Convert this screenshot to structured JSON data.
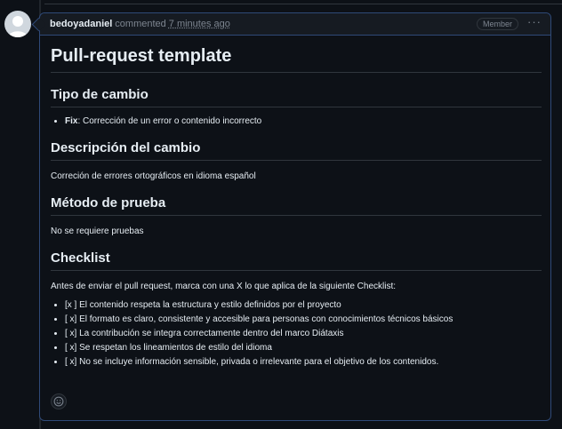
{
  "comment": {
    "author": "bedoyadaniel",
    "action": "commented",
    "time": "7 minutes ago",
    "badge": "Member",
    "menu_icon": "kebab-horizontal-icon"
  },
  "content": {
    "title": "Pull-request template",
    "type_heading": "Tipo de cambio",
    "type_items": [
      {
        "strong": "Fix",
        "text": ": Corrección de un error o contenido incorrecto"
      }
    ],
    "desc_heading": "Descripción del cambio",
    "desc_text": "Correción de errores ortográficos en idioma español",
    "test_heading": "Método de prueba",
    "test_text": "No se requiere pruebas",
    "checklist_heading": "Checklist",
    "checklist_intro": "Antes de enviar el pull request, marca con una X lo que aplica de la siguiente Checklist:",
    "checklist_items": [
      "[x ] El contenido respeta la estructura y estilo definidos por el proyecto",
      "[ x] El formato es claro, consistente y accesible para personas con conocimientos técnicos básicos",
      "[ x] La contribución se integra correctamente dentro del marco Diátaxis",
      "[ x] Se respetan los lineamientos de estilo del idioma",
      "[ x] No se incluye información sensible, privada o irrelevante para el objetivo de los contenidos."
    ]
  },
  "colors": {
    "background": "#0d1117",
    "border_accent": "#2f4a78",
    "text": "#e6edf3",
    "muted": "#7d8590"
  }
}
